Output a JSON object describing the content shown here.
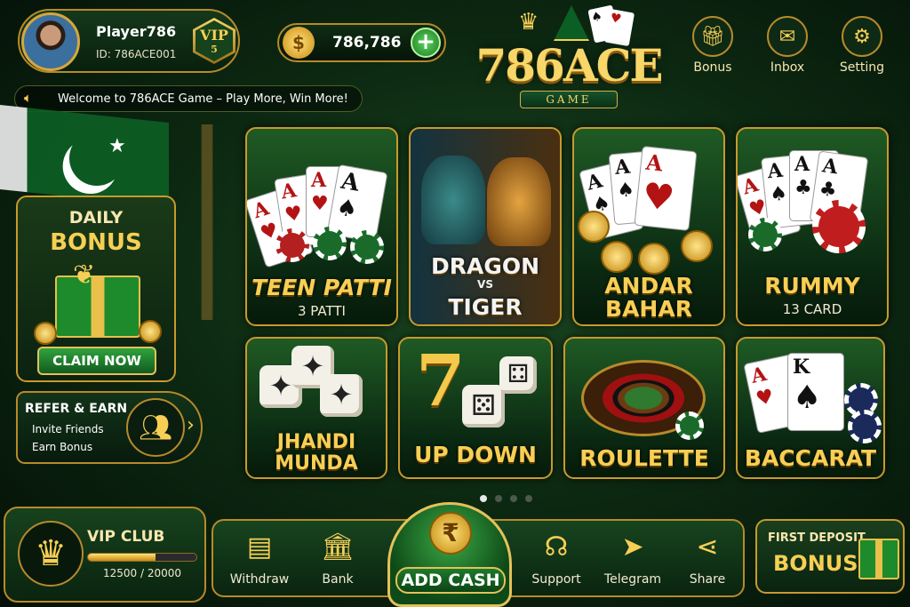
{
  "profile": {
    "name": "Player786",
    "id": "ID: 786ACE001",
    "vip_label": "VIP",
    "vip_level": "5"
  },
  "wallet": {
    "balance": "786,786",
    "coin_symbol": "$",
    "add_symbol": "+"
  },
  "logo": {
    "title": "786ACE",
    "subtitle": "GAME"
  },
  "header_buttons": [
    {
      "label": "Bonus",
      "icon": "gift-icon"
    },
    {
      "label": "Inbox",
      "icon": "mail-icon"
    },
    {
      "label": "Setting",
      "icon": "gear-icon"
    }
  ],
  "marquee": {
    "text": "Welcome to 786ACE Game – Play More, Win More!"
  },
  "daily_bonus": {
    "line1": "DAILY",
    "line2": "BONUS",
    "button": "CLAIM NOW"
  },
  "refer": {
    "title": "REFER & EARN",
    "line1": "Invite Friends",
    "line2": "Earn Bonus"
  },
  "games": [
    {
      "name": "TEEN PATTI",
      "sub": "3 PATTI"
    },
    {
      "name_l1": "DRAGON",
      "vs": "VS",
      "name_l2": "TIGER"
    },
    {
      "name_l1": "ANDAR",
      "name_l2": "BAHAR"
    },
    {
      "name": "RUMMY",
      "sub": "13 CARD"
    },
    {
      "name_l1": "JHANDI",
      "name_l2": "MUNDA"
    },
    {
      "name": "UP DOWN",
      "big": "7"
    },
    {
      "name": "ROULETTE"
    },
    {
      "name": "BACCARAT"
    }
  ],
  "pager": {
    "pages": 4,
    "active": 0
  },
  "vip_club": {
    "title": "VIP CLUB",
    "progress": "12500 / 20000",
    "fraction": 0.625
  },
  "nav": [
    {
      "label": "Withdraw",
      "icon": "wallet-icon"
    },
    {
      "label": "Bank",
      "icon": "bank-icon"
    },
    {
      "label": "Support",
      "icon": "headset-icon"
    },
    {
      "label": "Telegram",
      "icon": "telegram-icon"
    },
    {
      "label": "Share",
      "icon": "share-icon"
    }
  ],
  "add_cash": {
    "label": "ADD CASH",
    "symbol": "₹"
  },
  "first_deposit": {
    "line1": "FIRST DEPOSIT",
    "line2": "BONUS"
  },
  "colors": {
    "gold": "#f7cf55",
    "green": "#0d2a12",
    "accent_green": "#2fa33d"
  }
}
